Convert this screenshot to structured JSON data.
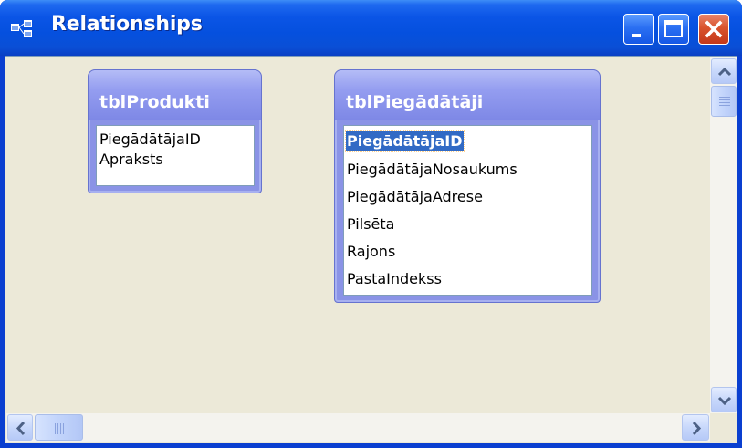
{
  "window": {
    "title": "Relationships",
    "app_icon": "relationships-icon",
    "controls": {
      "minimize_icon": "minimize-icon",
      "maximize_icon": "maximize-icon",
      "close_icon": "close-icon"
    },
    "colors": {
      "titlebar": "#0550de",
      "close_button": "#d9532d",
      "client_background": "#ece9d8",
      "table_header": "#949df0",
      "selection": "#316ac5"
    }
  },
  "tables": [
    {
      "name": "tblProdukti",
      "fields": [
        "PiegādātājaID",
        "Apraksts"
      ]
    },
    {
      "name": "tblPiegādātāji",
      "fields": [
        "PiegādātājaID",
        "PiegādātājaNosaukums",
        "PiegādātājaAdrese",
        "Pilsēta",
        "Rajons",
        "PastaIndekss"
      ],
      "selected_field": "PiegādātājaID"
    }
  ],
  "scrollbars": {
    "vertical": {
      "up_icon": "scroll-up-icon",
      "down_icon": "scroll-down-icon"
    },
    "horizontal": {
      "left_icon": "scroll-left-icon",
      "right_icon": "scroll-right-icon"
    }
  }
}
